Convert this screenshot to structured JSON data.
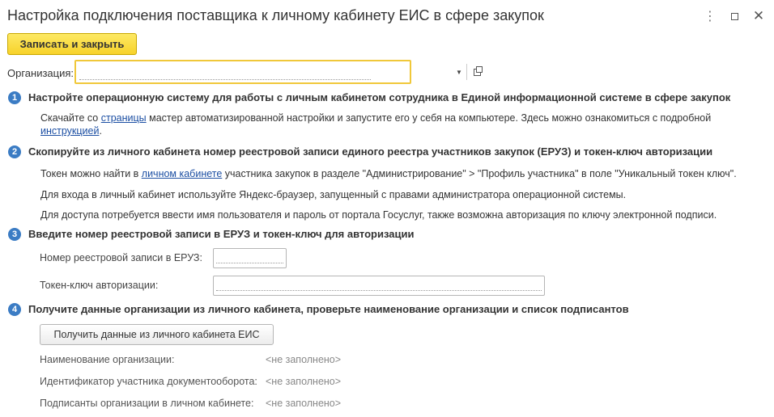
{
  "window": {
    "title": "Настройка подключения поставщика к личному кабинету ЕИС в сфере закупок",
    "more_glyph": "⋮",
    "close_glyph": "✕"
  },
  "toolbar": {
    "save_close_label": "Записать и закрыть"
  },
  "organization": {
    "label": "Организация:",
    "value": "",
    "dropdown_glyph": "▼"
  },
  "steps": [
    {
      "number": "1",
      "heading": "Настройте операционную систему для работы с личным кабинетом сотрудника в Единой информационной системе в сфере закупок",
      "p1_before": "Скачайте со ",
      "p1_link": "страницы",
      "p1_after": " мастер автоматизированной настройки и запустите его у себя на компьютере. Здесь можно ознакомиться с подробной",
      "p1_link2": "инструкцией",
      "p1_end": "."
    },
    {
      "number": "2",
      "heading": "Скопируйте из личного кабинета номер реестровой записи единого реестра участников закупок (ЕРУЗ) и токен-ключ авторизации",
      "p1_before": "Токен можно найти в ",
      "p1_link": "личном кабинете",
      "p1_after": " участника закупок в разделе \"Администрирование\" > \"Профиль участника\" в поле \"Уникальный токен ключ\".",
      "p2": "Для входа в личный кабинет используйте Яндекс-браузер, запущенный с правами администратора операционной системы.",
      "p3": "Для доступа потребуется ввести имя пользователя и пароль от портала Госуслуг, также возможна авторизация по ключу электронной подписи."
    },
    {
      "number": "3",
      "heading": "Введите номер реестровой записи в ЕРУЗ и токен-ключ для авторизации",
      "field1_label": "Номер реестровой записи в ЕРУЗ:",
      "field1_value": "",
      "field2_label": "Токен-ключ авторизации:",
      "field2_value": ""
    },
    {
      "number": "4",
      "heading": "Получите данные организации из личного кабинета, проверьте наименование организации и список подписантов",
      "button_label": "Получить данные из личного кабинета ЕИС",
      "info": [
        {
          "label": "Наименование организации:",
          "value": "<не заполнено>"
        },
        {
          "label": "Идентификатор участника документооборота:",
          "value": "<не заполнено>"
        },
        {
          "label": "Подписанты организации в личном кабинете:",
          "value": "<не заполнено>"
        }
      ]
    }
  ]
}
